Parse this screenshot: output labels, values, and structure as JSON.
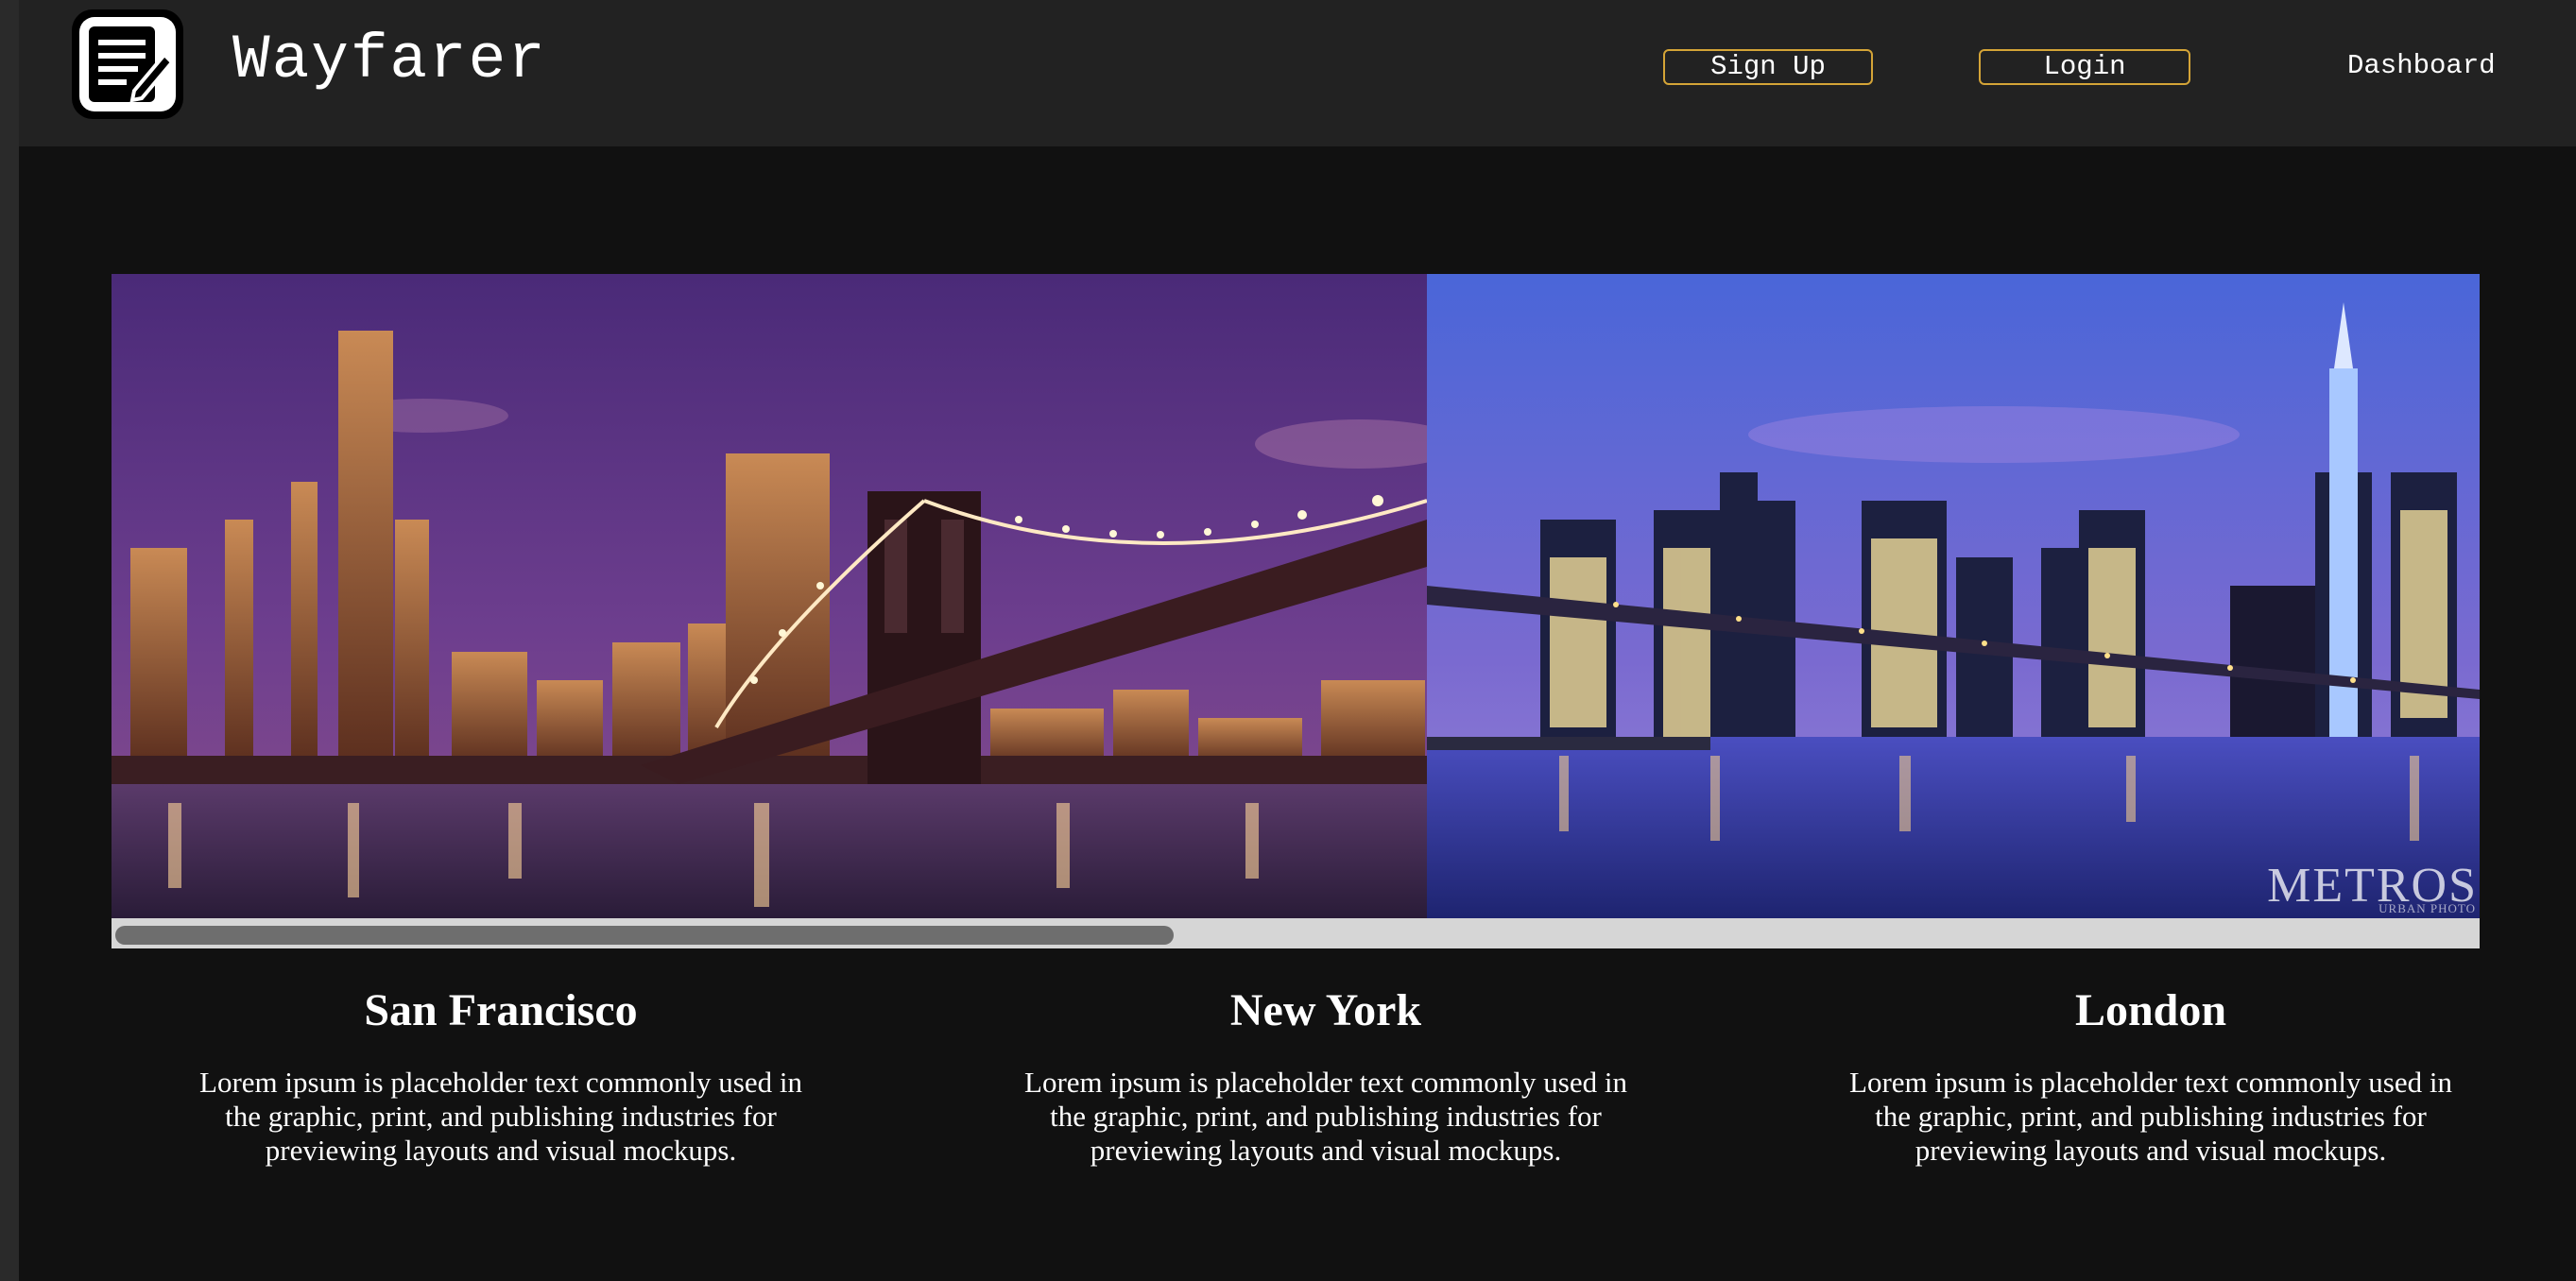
{
  "header": {
    "brand": "Wayfarer",
    "logo_icon": "notepad-pencil-icon",
    "signup_label": "Sign Up",
    "login_label": "Login",
    "dashboard_label": "Dashboard"
  },
  "carousel": {
    "slides": [
      {
        "scene": "brooklyn-bridge-purple-sunset"
      },
      {
        "scene": "manhattan-skyline-blue-dusk"
      }
    ],
    "watermark": "METROS",
    "watermark_sub": "URBAN PHOTO"
  },
  "cities": [
    {
      "name": "San Francisco",
      "description": "Lorem ipsum is placeholder text commonly used in the graphic, print, and publishing industries for previewing layouts and visual mockups."
    },
    {
      "name": "New York",
      "description": "Lorem ipsum is placeholder text commonly used in the graphic, print, and publishing industries for previewing layouts and visual mockups."
    },
    {
      "name": "London",
      "description": "Lorem ipsum is placeholder text commonly used in the graphic, print, and publishing industries for previewing layouts and visual mockups."
    }
  ],
  "colors": {
    "navbar": "#222222",
    "background": "#111111",
    "button_border": "#d4a437"
  }
}
